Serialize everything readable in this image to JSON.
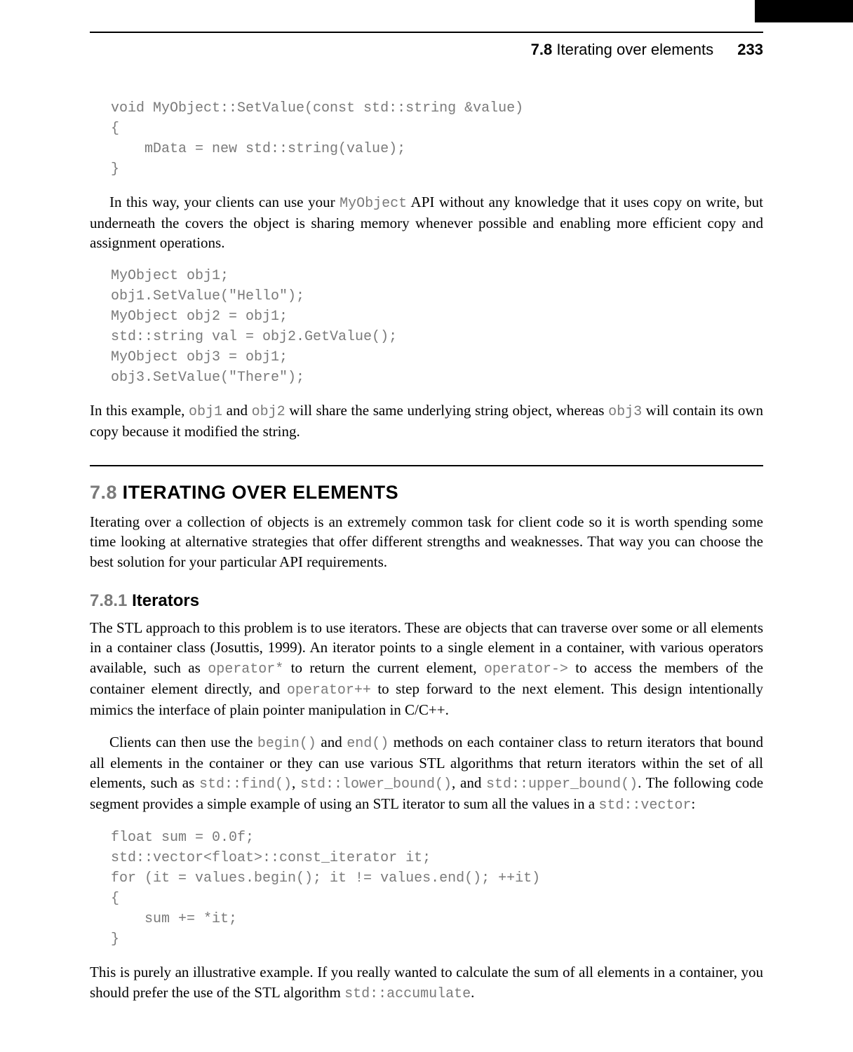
{
  "header": {
    "section_number": "7.8",
    "section_title": "Iterating over elements",
    "page_number": "233"
  },
  "code_block_1": "void MyObject::SetValue(const std::string &value)\n{\n    mData = new std::string(value);\n}",
  "para_1_a": "In this way, your clients can use your ",
  "para_1_code_1": "MyObject",
  "para_1_b": " API without any knowledge that it uses copy on write, but underneath the covers the object is sharing memory whenever possible and enabling more efficient copy and assignment operations.",
  "code_block_2": "MyObject obj1;\nobj1.SetValue(\"Hello\");\nMyObject obj2 = obj1;\nstd::string val = obj2.GetValue();\nMyObject obj3 = obj1;\nobj3.SetValue(\"There\");",
  "para_2_a": "In this example, ",
  "para_2_code_1": "obj1",
  "para_2_b": " and ",
  "para_2_code_2": "obj2",
  "para_2_c": " will share the same underlying string object, whereas ",
  "para_2_code_3": "obj3",
  "para_2_d": " will contain its own copy because it modified the string.",
  "section": {
    "number": "7.8",
    "title": "ITERATING OVER ELEMENTS"
  },
  "para_3": "Iterating over a collection of objects is an extremely common task for client code so it is worth spending some time looking at alternative strategies that offer different strengths and weaknesses. That way you can choose the best solution for your particular API requirements.",
  "subsection": {
    "number": "7.8.1",
    "title": "Iterators"
  },
  "para_4_a": "The STL approach to this problem is to use iterators. These are objects that can traverse over some or all elements in a container class (Josuttis, 1999). An iterator points to a single element in a container, with various operators available, such as ",
  "para_4_code_1": "operator*",
  "para_4_b": " to return the current element, ",
  "para_4_code_2": "operator->",
  "para_4_c": " to access the members of the container element directly, and ",
  "para_4_code_3": "operator++",
  "para_4_d": " to step forward to the next element. This design intentionally mimics the interface of plain pointer manipulation in C/C++.",
  "para_5_a": "Clients can then use the ",
  "para_5_code_1": "begin()",
  "para_5_b": " and ",
  "para_5_code_2": "end()",
  "para_5_c": " methods on each container class to return iterators that bound all elements in the container or they can use various STL algorithms that return iterators within the set of all elements, such as ",
  "para_5_code_3": "std::find()",
  "para_5_d": ", ",
  "para_5_code_4": "std::lower_bound()",
  "para_5_e": ", and ",
  "para_5_code_5": "std::upper_bound()",
  "para_5_f": ". The following code segment provides a simple example of using an STL iterator to sum all the values in a ",
  "para_5_code_6": "std::vector",
  "para_5_g": ":",
  "code_block_3": "float sum = 0.0f;\nstd::vector<float>::const_iterator it;\nfor (it = values.begin(); it != values.end(); ++it)\n{\n    sum += *it;\n}",
  "para_6_a": "This is purely an illustrative example. If you really wanted to calculate the sum of all elements in a container, you should prefer the use of the STL algorithm ",
  "para_6_code_1": "std::accumulate",
  "para_6_b": "."
}
